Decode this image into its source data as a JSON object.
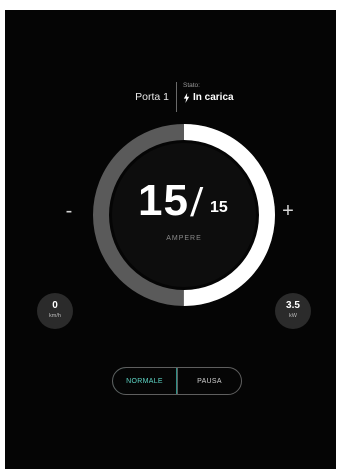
{
  "header": {
    "port_label": "Porta 1",
    "status_caption": "Stato:",
    "status_value": "In carica",
    "status_icon": "lightning-bolt-icon"
  },
  "gauge": {
    "current_value": "15",
    "separator": "/",
    "max_value": "15",
    "unit": "AMPERE",
    "fill_fraction": 0.5,
    "colors": {
      "filled": "#ffffff",
      "remaining": "#5a5a5a",
      "center": "#0d0d0d"
    }
  },
  "controls": {
    "decrease_label": "-",
    "increase_label": "+"
  },
  "metrics": {
    "speed": {
      "value": "0",
      "unit": "km/h"
    },
    "power": {
      "value": "3.5",
      "unit": "kW"
    }
  },
  "mode_toggle": {
    "options": [
      "NORMALE",
      "PAUSA"
    ],
    "selected": "NORMALE",
    "accent_color": "#5fd6c6"
  }
}
